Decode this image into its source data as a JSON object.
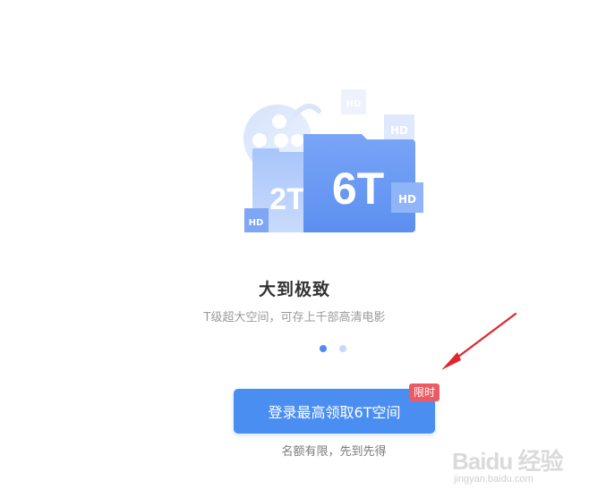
{
  "illustration": {
    "small_folder_label": "2T",
    "big_folder_label": "6T",
    "hd_badge": "HD"
  },
  "slide": {
    "title": "大到极致",
    "subtitle": "T级超大空间，可存上千部高清电影",
    "page_count": 2,
    "active_page": 1
  },
  "login_button": {
    "label": "登录最高领取6T空间",
    "badge": "限时"
  },
  "hint": "名额有限，先到先得",
  "watermark": {
    "main": "Baidu 经验",
    "sub": "jingyan.baidu.com"
  },
  "colors": {
    "accent": "#4b8ef2",
    "badge": "#ec5b63",
    "arrow": "#e0262b"
  }
}
